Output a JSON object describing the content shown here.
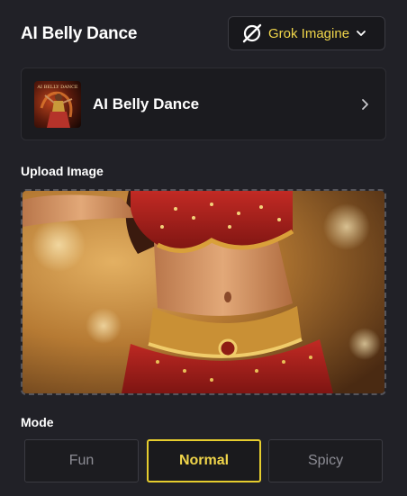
{
  "header": {
    "title": "AI Belly Dance",
    "model_select": {
      "selected": "Grok Imagine",
      "icon": "grok-icon",
      "accent_color": "#f0d54a"
    }
  },
  "template": {
    "name": "AI Belly Dance",
    "thumbnail_text": "AI BELLY DANCE",
    "icon": "chevron-right-icon"
  },
  "upload": {
    "label": "Upload Image"
  },
  "mode": {
    "label": "Mode",
    "options": [
      "Fun",
      "Normal",
      "Spicy"
    ],
    "selected": "Normal"
  },
  "colors": {
    "background": "#212127",
    "accent": "#e6cd2e"
  }
}
